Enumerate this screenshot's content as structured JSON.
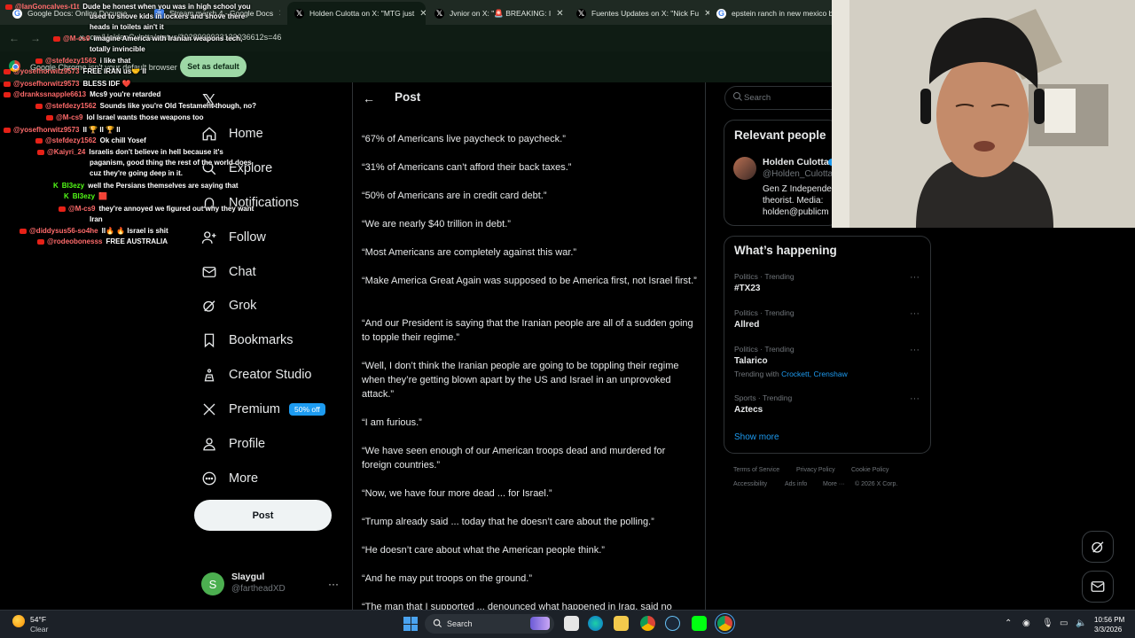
{
  "browser": {
    "tabs": [
      {
        "label": "Google Docs: Online Docume...",
        "icon": "google-icon"
      },
      {
        "label": "Stream march 4 - Google Docs",
        "icon": "docs-icon"
      },
      {
        "label": "Holden Culotta on X: \"MTG just",
        "icon": "x-icon"
      },
      {
        "label": "Jvnior on X: \"🚨 BREAKING: I",
        "icon": "x-icon"
      },
      {
        "label": "Fuentes Updates on X: \"Nick Fu",
        "icon": "x-icon"
      },
      {
        "label": "epstein ranch in new mexico bo",
        "icon": "google-icon"
      }
    ],
    "url": "x.com/HoldenCulotta/status/2028909933133036612s=46",
    "infobar_text": "Google Chrome isn't your default browser",
    "set_default_label": "Set as default"
  },
  "chat": [
    {
      "user": "@IanGoncalves-t1t",
      "text": "Dude be honest when you was in high school you",
      "ucolor": "#ff6b6b"
    },
    {
      "user": "",
      "text": "used to shove kids in lockers and shove there",
      "ucolor": "#ff6b6b"
    },
    {
      "user": "",
      "text": "heads in toilets ain't it",
      "ucolor": "#ff6b6b"
    },
    {
      "user": "@M-cs9",
      "text": "imagine America with Iranian weapons tech,",
      "ucolor": "#ff6b6b"
    },
    {
      "user": "",
      "text": "totally invincible",
      "ucolor": "#ff6b6b"
    },
    {
      "user": "@stefdezy1562",
      "text": "i like that",
      "ucolor": "#ff6b6b"
    },
    {
      "user": "@yosefhorwitz9573",
      "text": "FREE IRAN us🤝 II",
      "ucolor": "#ff6b6b"
    },
    {
      "user": "@yosefhorwitz9573",
      "text": "BLESS IDF ❤️",
      "ucolor": "#ff6b6b"
    },
    {
      "user": "@drankssnapple6613",
      "text": "Mcs9 you're retarded",
      "ucolor": "#ff6b6b"
    },
    {
      "user": "@stefdezy1562",
      "text": "Sounds like you're Old Testament though, no?",
      "ucolor": "#ff6b6b"
    },
    {
      "user": "@M-cs9",
      "text": "lol Israel wants those weapons too",
      "ucolor": "#ff6b6b"
    },
    {
      "user": "@yosefhorwitz9573",
      "text": "II 🏆 II 🏆 II",
      "ucolor": "#ff6b6b"
    },
    {
      "user": "@stefdezy1562",
      "text": "Ok chill Yosef",
      "ucolor": "#ff6b6b"
    },
    {
      "user": "@Kaiyri_24",
      "text": "Israelis don't believe in hell because it's",
      "ucolor": "#ff6b6b"
    },
    {
      "user": "",
      "text": "paganism, good thing the rest of the world does",
      "ucolor": "#ff6b6b"
    },
    {
      "user": "",
      "text": "cuz they're going deep in it.",
      "ucolor": "#ff6b6b"
    },
    {
      "user": "Bl3ezy",
      "text": "well the Persians themselves are saying that",
      "ucolor": "#53fc18"
    },
    {
      "user": "Bl3ezy",
      "text": "🟥",
      "ucolor": "#53fc18"
    },
    {
      "user": "@M-cs9",
      "text": "they're annoyed we figured out why they want",
      "ucolor": "#ff6b6b"
    },
    {
      "user": "",
      "text": "Iran",
      "ucolor": "#ff6b6b"
    },
    {
      "user": "@diddysus56-so4he",
      "text": "II🔥 🔥 Israel is shit",
      "ucolor": "#ff6b6b"
    },
    {
      "user": "@rodeobonesss",
      "text": "FREE AUSTRALIA",
      "ucolor": "#ff6b6b"
    }
  ],
  "nav": {
    "items": [
      {
        "label": "Home",
        "icon": "home-icon"
      },
      {
        "label": "Explore",
        "icon": "search-icon"
      },
      {
        "label": "Notifications",
        "icon": "bell-icon"
      },
      {
        "label": "Follow",
        "icon": "follow-icon"
      },
      {
        "label": "Chat",
        "icon": "mail-icon"
      },
      {
        "label": "Grok",
        "icon": "grok-icon"
      },
      {
        "label": "Bookmarks",
        "icon": "bookmark-icon"
      },
      {
        "label": "Creator Studio",
        "icon": "creator-icon"
      },
      {
        "label": "Premium",
        "icon": "x-icon"
      },
      {
        "label": "Profile",
        "icon": "person-icon"
      },
      {
        "label": "More",
        "icon": "more-icon"
      }
    ],
    "premium_badge": "50% off",
    "post_label": "Post"
  },
  "account": {
    "name": "Slaygul",
    "handle": "@fartheadXD",
    "initial": "S"
  },
  "main": {
    "title": "Post",
    "quotes": [
      "“67% of Americans live paycheck to paycheck.”",
      "“31% of Americans can’t afford their back taxes.”",
      "“50% of Americans are in credit card debt.”",
      "“We are nearly $40 trillion in debt.”",
      "“Most Americans are completely against this war.”",
      "“Make America Great Again was supposed to be America first, not Israel first.”",
      "“And our President is saying that the Iranian people are all of a sudden going to topple their regime.”",
      "“Well, I don’t think the Iranian people are going to be toppling their regime when they’re getting blown apart by the US and Israel in an unprovoked attack.”",
      "“I am furious.”",
      "“We have seen enough of our American troops dead and murdered for foreign countries.”",
      "“Now, we have four more dead ... for Israel.”",
      "“Trump already said ... today that he doesn’t care about the polling.”",
      "“He doesn’t care about what the American people think.”",
      "“And he may put troops on the ground.”",
      "“The man that I supported ... denounced what happened in Iraq, said no"
    ]
  },
  "right": {
    "search_placeholder": "Search",
    "relevant_title": "Relevant people",
    "relevant": {
      "name": "Holden Culotta",
      "handle": "@Holden_Culotta",
      "bio": [
        "Gen Z Independe",
        "theorist. Media:",
        "holden@publicm"
      ]
    },
    "happening_title": "What’s happening",
    "trends": [
      {
        "meta": "Politics · Trending",
        "name": "#TX23",
        "with": ""
      },
      {
        "meta": "Politics · Trending",
        "name": "Allred",
        "with": ""
      },
      {
        "meta": "Politics · Trending",
        "name": "Talarico",
        "with_label": "Trending with",
        "with": "Crockett, Crenshaw"
      },
      {
        "meta": "Sports · Trending",
        "name": "Aztecs",
        "with": ""
      }
    ],
    "show_more": "Show more",
    "footer": [
      "Terms of Service",
      "Privacy Policy",
      "Cookie Policy",
      "Accessibility",
      "Ads info",
      "More ···",
      "© 2026 X Corp."
    ]
  },
  "taskbar": {
    "temp": "54°F",
    "condition": "Clear",
    "search_label": "Search",
    "time": "10:56 PM",
    "date": "3/3/2026"
  },
  "colors": {
    "accent": "#1d9bf0",
    "bg": "#000000",
    "text": "#e7e9ea",
    "muted": "#71767b",
    "border": "#2f3336"
  }
}
